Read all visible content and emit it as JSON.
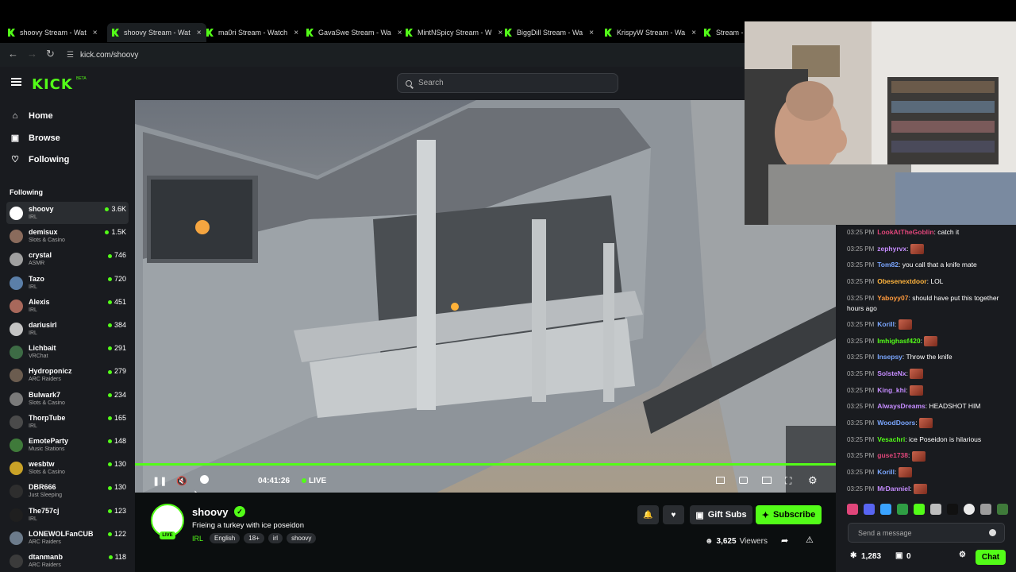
{
  "browser": {
    "tabs": [
      {
        "label": "shoovy Stream - Wat",
        "active": false
      },
      {
        "label": "shoovy Stream - Wat",
        "active": true
      },
      {
        "label": "ma0ri Stream - Watch",
        "active": false
      },
      {
        "label": "GavaSwe Stream - Wa",
        "active": false
      },
      {
        "label": "MintNSpicy Stream - W",
        "active": false
      },
      {
        "label": "BiggDill Stream - Wa",
        "active": false
      },
      {
        "label": "KrispyW Stream - Wa",
        "active": false
      },
      {
        "label": "Stream -",
        "active": false
      }
    ],
    "url": "kick.com/shoovy"
  },
  "header": {
    "logo": "KICK",
    "logo_badge": "BETA",
    "search_placeholder": "Search"
  },
  "sidebar": {
    "nav": [
      {
        "label": "Home",
        "icon": "home-icon"
      },
      {
        "label": "Browse",
        "icon": "browse-icon"
      },
      {
        "label": "Following",
        "icon": "heart-icon"
      }
    ],
    "following_heading": "Following",
    "channels": [
      {
        "name": "shoovy",
        "category": "IRL",
        "viewers": "3.6K",
        "color": "#ffffff"
      },
      {
        "name": "demisux",
        "category": "Slots & Casino",
        "viewers": "1.5K",
        "color": "#8a6b5c"
      },
      {
        "name": "crystal",
        "category": "ASMR",
        "viewers": "746",
        "color": "#a0a0a0"
      },
      {
        "name": "Tazo",
        "category": "IRL",
        "viewers": "720",
        "color": "#5b7fa8"
      },
      {
        "name": "Alexis",
        "category": "IRL",
        "viewers": "451",
        "color": "#a8685b"
      },
      {
        "name": "dariusirl",
        "category": "IRL",
        "viewers": "384",
        "color": "#c4c4c4"
      },
      {
        "name": "Lichbait",
        "category": "VRChat",
        "viewers": "291",
        "color": "#3d6b45"
      },
      {
        "name": "Hydroponicz",
        "category": "ARC Raiders",
        "viewers": "279",
        "color": "#6b5c4f"
      },
      {
        "name": "Bulwark7",
        "category": "Slots & Casino",
        "viewers": "234",
        "color": "#7a7a7a"
      },
      {
        "name": "ThorpTube",
        "category": "IRL",
        "viewers": "165",
        "color": "#4a4a4a"
      },
      {
        "name": "EmoteParty",
        "category": "Music Stations",
        "viewers": "148",
        "color": "#3f7a3a"
      },
      {
        "name": "wesbtw",
        "category": "Slots & Casino",
        "viewers": "130",
        "color": "#c9a227"
      },
      {
        "name": "DBR666",
        "category": "Just Sleeping",
        "viewers": "130",
        "color": "#2e2e2e"
      },
      {
        "name": "The757cj",
        "category": "IRL",
        "viewers": "123",
        "color": "#1f1f1f"
      },
      {
        "name": "LONEWOLFanCUB",
        "category": "ARC Raiders",
        "viewers": "122",
        "color": "#6c7b8b"
      },
      {
        "name": "dtanmanb",
        "category": "ARC Raiders",
        "viewers": "118",
        "color": "#3b3b3b"
      }
    ]
  },
  "player": {
    "timecode": "04:41:26",
    "live_label": "LIVE",
    "progress": 1.0
  },
  "stream": {
    "streamer": "shoovy",
    "live_badge": "LIVE",
    "title": "Frieing a turkey with ice poseidon",
    "category": "IRL",
    "tags": [
      "English",
      "18+",
      "irl",
      "shoovy"
    ],
    "viewer_count": "3,625",
    "viewers_label": "Viewers",
    "gift_subs_label": "Gift Subs",
    "subscribe_label": "Subscribe"
  },
  "chat": {
    "messages": [
      {
        "time": "03:25 PM",
        "user": "LookAtTheGoblin",
        "color": "#e0467a",
        "text": "catch it",
        "emote": false
      },
      {
        "time": "03:25 PM",
        "user": "zephyrvx",
        "color": "#c58cff",
        "text": "",
        "emote": true
      },
      {
        "time": "03:25 PM",
        "user": "Tom82",
        "color": "#7aa6ff",
        "text": "you call that a knife mate",
        "emote": false
      },
      {
        "time": "03:25 PM",
        "user": "Obesenextdoor",
        "color": "#ffb43d",
        "text": "LOL",
        "emote": false
      },
      {
        "time": "03:25 PM",
        "user": "Yaboyy07",
        "color": "#ff9a3d",
        "text": "should have put this together hours ago",
        "emote": false
      },
      {
        "time": "03:25 PM",
        "user": "Korill",
        "color": "#7aa6ff",
        "text": "",
        "emote": true
      },
      {
        "time": "03:25 PM",
        "user": "Imhighasf420",
        "color": "#53fc18",
        "text": "",
        "emote": true
      },
      {
        "time": "03:25 PM",
        "user": "Insepsy",
        "color": "#7aa6ff",
        "text": "Throw the knife",
        "emote": false
      },
      {
        "time": "03:25 PM",
        "user": "SolsteNx",
        "color": "#c58cff",
        "text": "",
        "emote": true
      },
      {
        "time": "03:25 PM",
        "user": "King_khi",
        "color": "#c58cff",
        "text": "",
        "emote": true
      },
      {
        "time": "03:25 PM",
        "user": "AlwaysDreams",
        "color": "#c58cff",
        "text": "HEADSHOT HIM",
        "emote": false
      },
      {
        "time": "03:25 PM",
        "user": "WoodDoors",
        "color": "#7aa6ff",
        "text": "",
        "emote": true
      },
      {
        "time": "03:25 PM",
        "user": "Vesachri",
        "color": "#53fc18",
        "text": "ice Poseidon is hilarious",
        "emote": false
      },
      {
        "time": "03:25 PM",
        "user": "guse1738",
        "color": "#e0467a",
        "text": "",
        "emote": true
      },
      {
        "time": "03:25 PM",
        "user": "Korill",
        "color": "#7aa6ff",
        "text": "",
        "emote": true
      },
      {
        "time": "03:25 PM",
        "user": "MrDanniel",
        "color": "#c58cff",
        "text": "",
        "emote": true
      }
    ],
    "input_placeholder": "Send a message",
    "points": "1,283",
    "gifts": "0",
    "chat_button": "Chat"
  }
}
